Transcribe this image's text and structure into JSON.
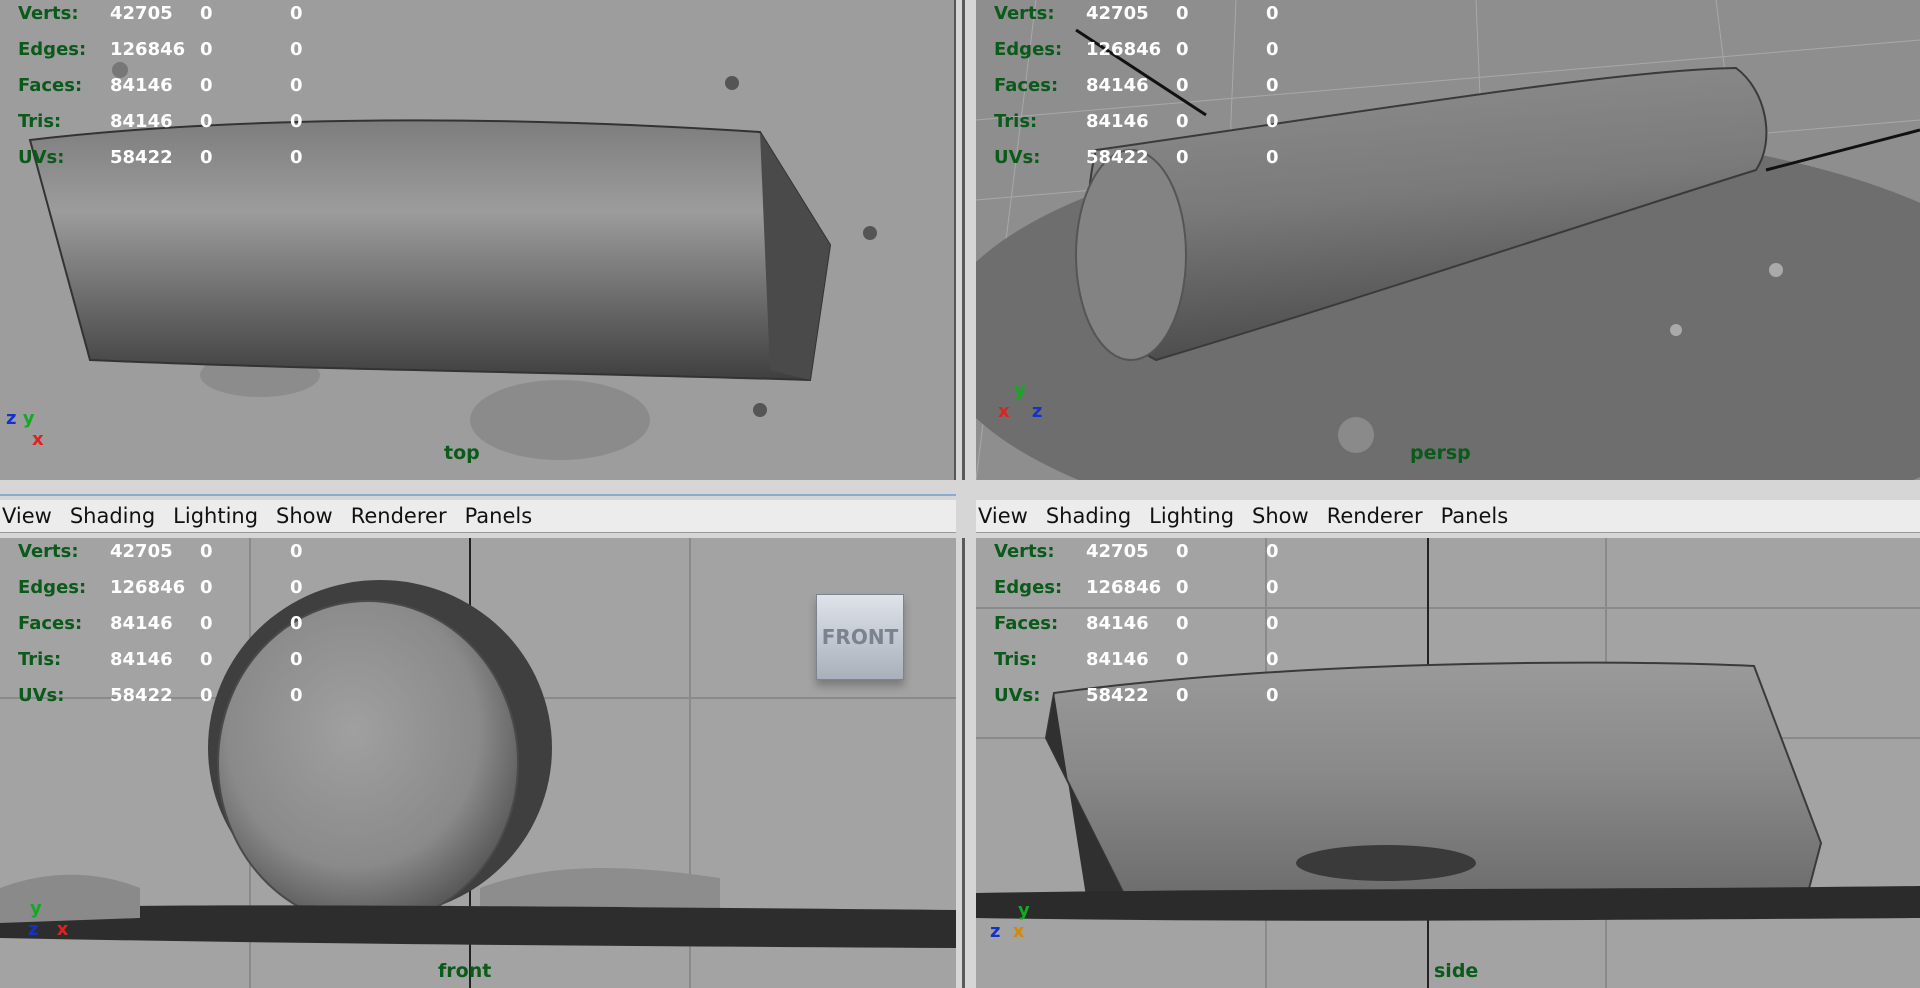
{
  "stats": {
    "rows": [
      {
        "label": "Verts:",
        "v1": "42705",
        "v2": "0",
        "v3": "0"
      },
      {
        "label": "Edges:",
        "v1": "126846",
        "v2": "0",
        "v3": "0"
      },
      {
        "label": "Faces:",
        "v1": "84146",
        "v2": "0",
        "v3": "0"
      },
      {
        "label": "Tris:",
        "v1": "84146",
        "v2": "0",
        "v3": "0"
      },
      {
        "label": "UVs:",
        "v1": "58422",
        "v2": "0",
        "v3": "0"
      }
    ]
  },
  "viewports": {
    "top": {
      "camera": "top"
    },
    "persp": {
      "camera": "persp"
    },
    "front": {
      "camera": "front",
      "view_cube": "FRONT"
    },
    "side": {
      "camera": "side"
    }
  },
  "menu": {
    "items": [
      "View",
      "Shading",
      "Lighting",
      "Show",
      "Renderer",
      "Panels"
    ]
  },
  "axes": {
    "x": "x",
    "y": "y",
    "z": "z"
  },
  "colors": {
    "hud_label": "#0a5a1a",
    "hud_value": "#ffffff",
    "axis_x": "#dd2222",
    "axis_y": "#11aa22",
    "axis_z": "#1133cc"
  }
}
